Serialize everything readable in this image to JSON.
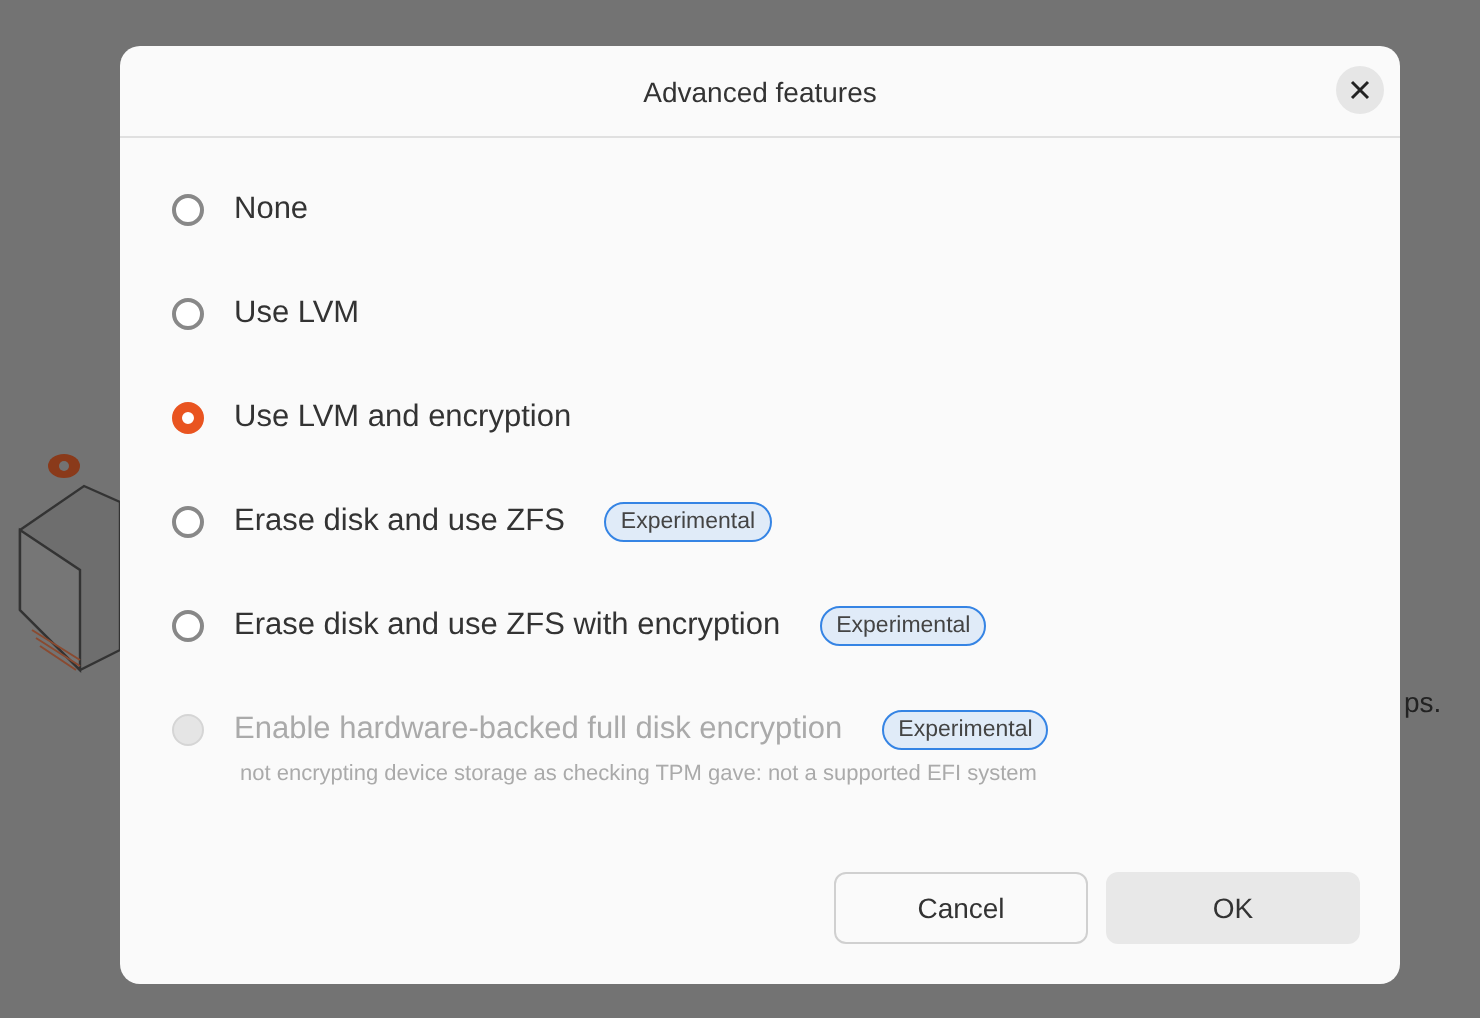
{
  "background": {
    "text": "ps."
  },
  "dialog": {
    "title": "Advanced features",
    "options": [
      {
        "label": "None",
        "selected": false,
        "disabled": false
      },
      {
        "label": "Use LVM",
        "selected": false,
        "disabled": false
      },
      {
        "label": "Use LVM and encryption",
        "selected": true,
        "disabled": false
      },
      {
        "label": "Erase disk and use ZFS",
        "selected": false,
        "disabled": false,
        "badge": "Experimental"
      },
      {
        "label": "Erase disk and use ZFS with encryption",
        "selected": false,
        "disabled": false,
        "badge": "Experimental"
      },
      {
        "label": "Enable hardware-backed full disk encryption",
        "selected": false,
        "disabled": true,
        "badge": "Experimental",
        "note": "not encrypting device storage as checking TPM gave: not a supported EFI system"
      }
    ],
    "buttons": [
      {
        "label": "Cancel",
        "kind": "secondary"
      },
      {
        "label": "OK",
        "kind": "primary"
      }
    ]
  }
}
